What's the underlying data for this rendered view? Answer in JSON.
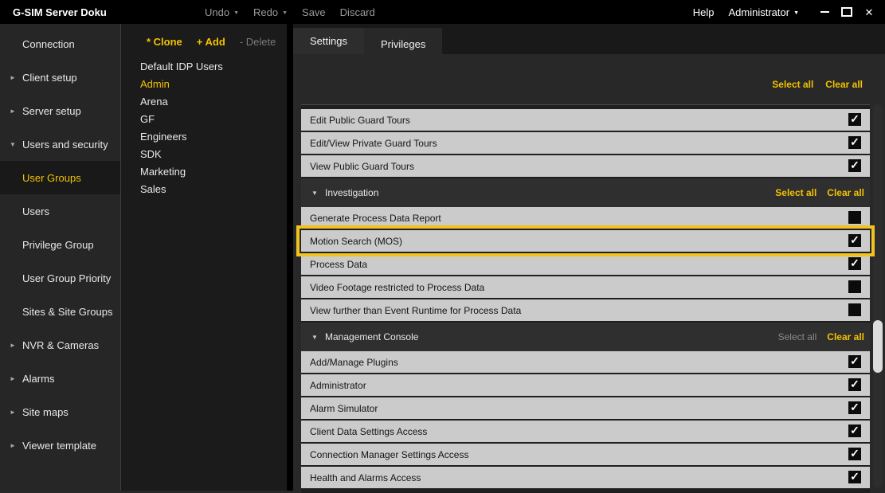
{
  "titlebar": {
    "title": "G-SIM Server Doku",
    "undo_label": "Undo",
    "redo_label": "Redo",
    "save_label": "Save",
    "discard_label": "Discard",
    "help_label": "Help",
    "user_label": "Administrator"
  },
  "icons": {
    "dropdown_caret": "▼",
    "collapsed_arrow": "►",
    "expanded_arrow": "▼",
    "checkmark": "✓",
    "close": "✕"
  },
  "sidebar": {
    "items": [
      {
        "label": "Connection",
        "arrow": "none",
        "selected": false
      },
      {
        "label": "Client setup",
        "arrow": "collapsed",
        "selected": false
      },
      {
        "label": "Server setup",
        "arrow": "collapsed",
        "selected": false
      },
      {
        "label": "Users and security",
        "arrow": "expanded",
        "selected": false
      },
      {
        "label": "User Groups",
        "arrow": "none",
        "selected": true
      },
      {
        "label": "Users",
        "arrow": "none",
        "selected": false
      },
      {
        "label": "Privilege Group",
        "arrow": "none",
        "selected": false
      },
      {
        "label": "User Group Priority",
        "arrow": "none",
        "selected": false
      },
      {
        "label": "Sites & Site Groups",
        "arrow": "none",
        "selected": false
      },
      {
        "label": "NVR & Cameras",
        "arrow": "collapsed",
        "selected": false
      },
      {
        "label": "Alarms",
        "arrow": "collapsed",
        "selected": false
      },
      {
        "label": "Site maps",
        "arrow": "collapsed",
        "selected": false
      },
      {
        "label": "Viewer template",
        "arrow": "collapsed",
        "selected": false
      }
    ]
  },
  "groups": {
    "clone_label": "* Clone",
    "add_label": "+ Add",
    "delete_label": "- Delete",
    "items": [
      {
        "label": "Default IDP Users",
        "selected": false
      },
      {
        "label": "Admin",
        "selected": true
      },
      {
        "label": "Arena",
        "selected": false
      },
      {
        "label": "GF",
        "selected": false
      },
      {
        "label": "Engineers",
        "selected": false
      },
      {
        "label": "SDK",
        "selected": false
      },
      {
        "label": "Marketing",
        "selected": false
      },
      {
        "label": "Sales",
        "selected": false
      }
    ]
  },
  "main": {
    "tabs": [
      {
        "label": "Settings",
        "active": false
      },
      {
        "label": "Privileges",
        "active": true
      }
    ],
    "select_all_label": "Select all",
    "clear_all_label": "Clear all",
    "rows": [
      {
        "type": "item",
        "label": "Edit Public Guard Tours",
        "checked": true,
        "highlighted": false
      },
      {
        "type": "item",
        "label": "Edit/View Private Guard Tours",
        "checked": true,
        "highlighted": false
      },
      {
        "type": "item",
        "label": "View Public Guard Tours",
        "checked": true,
        "highlighted": false
      },
      {
        "type": "section",
        "label": "Investigation",
        "select_all_label": "Select all",
        "clear_all_label": "Clear all",
        "select_all_enabled": true,
        "clear_all_enabled": true
      },
      {
        "type": "item",
        "label": "Generate Process Data Report",
        "checked": false,
        "highlighted": false
      },
      {
        "type": "item",
        "label": "Motion Search (MOS)",
        "checked": true,
        "highlighted": true
      },
      {
        "type": "item",
        "label": "Process Data",
        "checked": true,
        "highlighted": false
      },
      {
        "type": "item",
        "label": "Video Footage restricted to Process Data",
        "checked": false,
        "highlighted": false
      },
      {
        "type": "item",
        "label": "View further than Event Runtime for Process Data",
        "checked": false,
        "highlighted": false
      },
      {
        "type": "section",
        "label": "Management Console",
        "select_all_label": "Select all",
        "clear_all_label": "Clear all",
        "select_all_enabled": false,
        "clear_all_enabled": true
      },
      {
        "type": "item",
        "label": "Add/Manage Plugins",
        "checked": true,
        "highlighted": false
      },
      {
        "type": "item",
        "label": "Administrator",
        "checked": true,
        "highlighted": false
      },
      {
        "type": "item",
        "label": "Alarm Simulator",
        "checked": true,
        "highlighted": false
      },
      {
        "type": "item",
        "label": "Client Data Settings Access",
        "checked": true,
        "highlighted": false
      },
      {
        "type": "item",
        "label": "Connection Manager Settings Access",
        "checked": true,
        "highlighted": false
      },
      {
        "type": "item",
        "label": "Health and Alarms Access",
        "checked": true,
        "highlighted": false
      }
    ]
  },
  "colors": {
    "accent_yellow": "#f3c200",
    "highlight_border": "#f1c31c",
    "row_bg": "#cbcbcb",
    "titlebar_bg": "#000000",
    "panel_bg": "#282828"
  }
}
